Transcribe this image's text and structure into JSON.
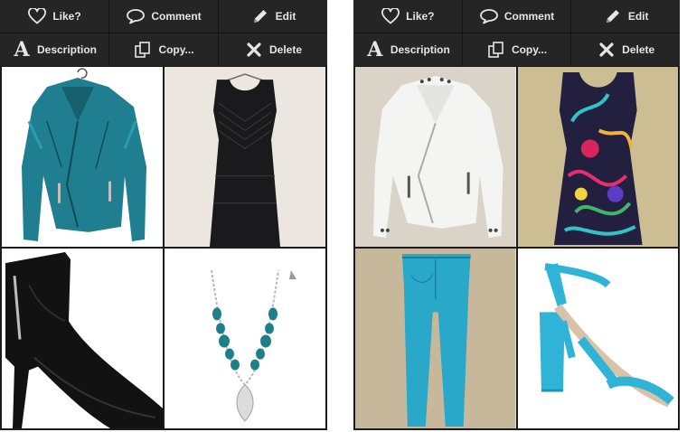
{
  "panels": [
    {
      "toolbar": {
        "like": "Like?",
        "comment": "Comment",
        "edit": "Edit",
        "description": "Description",
        "copy": "Copy...",
        "delete": "Delete"
      },
      "items": [
        {
          "name": "teal-leather-jacket",
          "color": "#1f7f90"
        },
        {
          "name": "black-sheath-dress",
          "color": "#1a1a1c"
        },
        {
          "name": "black-ankle-bootie",
          "color": "#121212"
        },
        {
          "name": "turquoise-statement-necklace",
          "color": "#1e7f8a"
        }
      ]
    },
    {
      "toolbar": {
        "like": "Like?",
        "comment": "Comment",
        "edit": "Edit",
        "description": "Description",
        "copy": "Copy...",
        "delete": "Delete"
      },
      "items": [
        {
          "name": "white-studded-moto-jacket",
          "color": "#f2f2f2"
        },
        {
          "name": "tropical-print-tank-top",
          "color": "#23203f"
        },
        {
          "name": "turquoise-skinny-pants",
          "color": "#2aa8c9"
        },
        {
          "name": "turquoise-block-heel-sandal",
          "color": "#2fb4d8"
        }
      ]
    }
  ],
  "icons": {
    "like": "heart-icon",
    "comment": "speech-bubble-icon",
    "edit": "pencil-icon",
    "description": "letter-a-icon",
    "copy": "copy-icon",
    "delete": "x-icon"
  }
}
